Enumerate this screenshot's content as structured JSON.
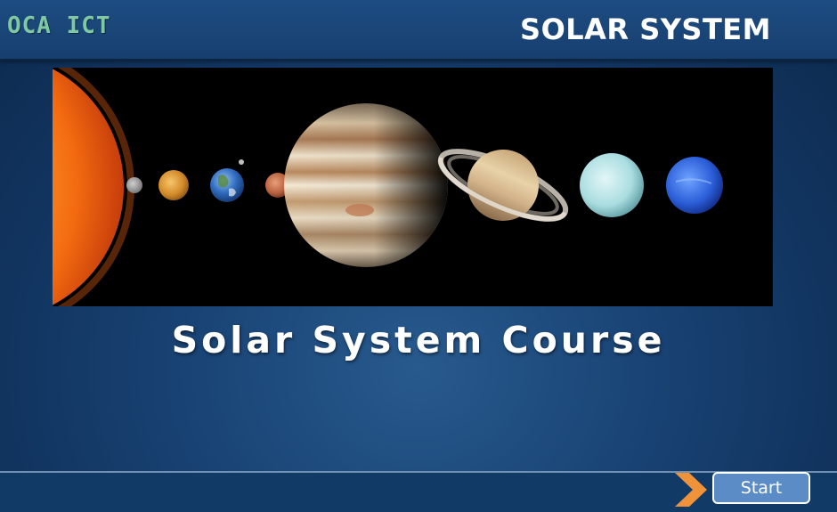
{
  "header": {
    "logo_text": "OCA ICT",
    "title": "SOLAR SYSTEM"
  },
  "banner": {
    "image_name": "solar-system-planets-image",
    "planets": [
      "sun",
      "mercury",
      "venus",
      "earth",
      "moon",
      "mars",
      "jupiter",
      "saturn",
      "uranus",
      "neptune"
    ]
  },
  "main": {
    "course_title": "Solar System Course"
  },
  "footer": {
    "start_label": "Start",
    "arrow_icon": "chevron-right-icon"
  },
  "colors": {
    "header_bg": "#1d4c82",
    "logo": "#7ec8a2",
    "footer_bg": "#123a67",
    "start_button_bg": "#5b8cc6",
    "arrow": "#f0923a"
  }
}
